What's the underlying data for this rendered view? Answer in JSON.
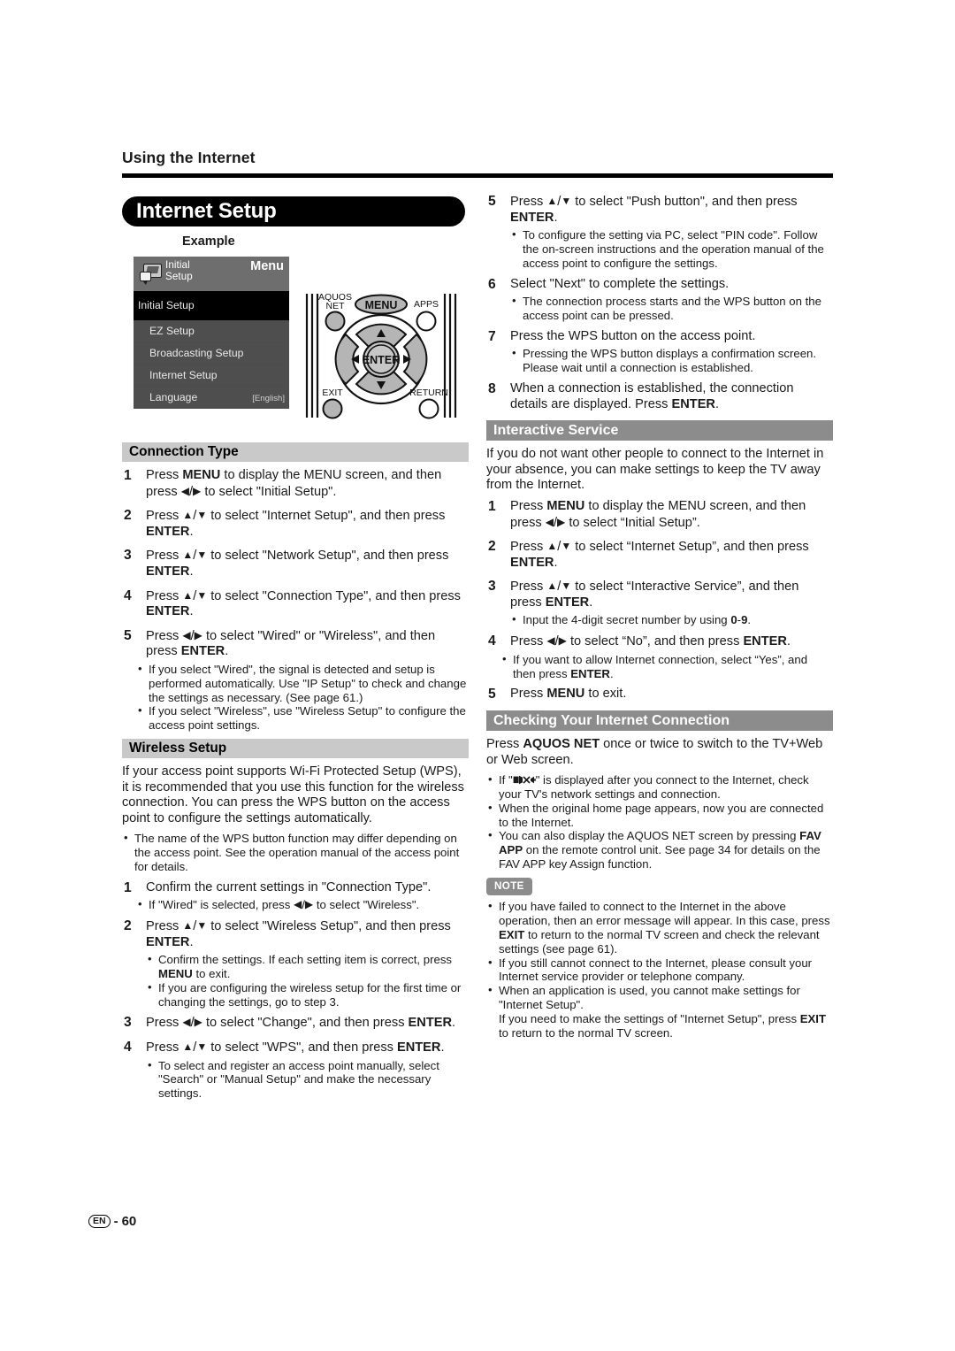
{
  "running_head": "Using the Internet",
  "page_title": "Internet Setup",
  "footer": {
    "lang_code": "EN",
    "separator": "-",
    "page_number": "60"
  },
  "example": {
    "label": "Example",
    "menu": {
      "header_icon": "initial-setup-icon",
      "header_title_line1": "Initial",
      "header_title_line2": "Setup",
      "header_right": "Menu",
      "rows": [
        {
          "label": "Initial Setup",
          "selected": true,
          "value": ""
        },
        {
          "label": "EZ Setup",
          "selected": false,
          "value": ""
        },
        {
          "label": "Broadcasting Setup",
          "selected": false,
          "value": ""
        },
        {
          "label": "Internet Setup",
          "selected": false,
          "value": ""
        },
        {
          "label": "Language",
          "selected": false,
          "value": "[English]"
        }
      ]
    },
    "remote": {
      "aquos_net": "AQUOS\nNET",
      "aquos_net_line1": "AQUOS",
      "aquos_net_line2": "NET",
      "menu": "MENU",
      "apps": "APPS",
      "enter": "ENTER",
      "exit": "EXIT",
      "return": "RETURN"
    }
  },
  "left_column": {
    "connection_type": {
      "heading": "Connection Type",
      "steps": [
        {
          "num": "1",
          "html": "Press <b>MENU</b> to display the MENU screen, and then press <span class=\"ar\">◀</span>/<span class=\"ar\">▶</span> to select \"Initial Setup\"."
        },
        {
          "num": "2",
          "html": "Press <span class=\"ar\">▲</span>/<span class=\"ar\">▼</span> to select \"Internet Setup\", and then press <b>ENTER</b>."
        },
        {
          "num": "3",
          "html": "Press <span class=\"ar\">▲</span>/<span class=\"ar\">▼</span> to select \"Network Setup\", and then press <b>ENTER</b>."
        },
        {
          "num": "4",
          "html": "Press <span class=\"ar\">▲</span>/<span class=\"ar\">▼</span> to select \"Connection Type\", and then press <b>ENTER</b>."
        },
        {
          "num": "5",
          "html": "Press <span class=\"ar\">◀</span>/<span class=\"ar\">▶</span> to select \"Wired\" or \"Wireless\", and then press <b>ENTER</b>."
        }
      ],
      "step5_bullets": [
        "If you select \"Wired\", the signal is detected and setup is performed automatically. Use \"IP Setup\" to check and change the settings as necessary. (See page 61.)",
        "If you select \"Wireless\", use \"Wireless Setup\" to configure the access point settings."
      ]
    },
    "wireless_setup": {
      "heading": "Wireless Setup",
      "intro": "If your access point supports Wi-Fi Protected Setup (WPS), it is recommended that you use this function for the wireless connection. You can press the WPS button on the access point to configure the settings automatically.",
      "intro_bullets": [
        "The name of the WPS button function may differ depending on the access point. See the operation manual of the access point for details."
      ],
      "steps": [
        {
          "num": "1",
          "html": "Confirm the current settings in \"Connection Type\"."
        },
        {
          "num": "2",
          "html": "Press <span class=\"ar\">▲</span>/<span class=\"ar\">▼</span> to select \"Wireless Setup\", and then press <b>ENTER</b>."
        },
        {
          "num": "3",
          "html": "Press <span class=\"ar\">◀</span>/<span class=\"ar\">▶</span> to select \"Change\", and then press <b>ENTER</b>."
        },
        {
          "num": "4",
          "html": "Press <span class=\"ar\">▲</span>/<span class=\"ar\">▼</span> to select \"WPS\", and then press <b>ENTER</b>."
        }
      ],
      "step1_bullets": [
        "If \"Wired\" is selected, press <span class=\"ar\">◀</span>/<span class=\"ar\">▶</span> to select \"Wireless\"."
      ],
      "step2_bullets": [
        "Confirm the settings. If each setting item is correct, press <b>MENU</b> to exit.",
        "If you are configuring the wireless setup for the first time or changing the settings, go to step 3."
      ],
      "step4_bullets": [
        "To select and register an access point manually, select \"Search\" or \"Manual Setup\" and make the necessary settings."
      ]
    }
  },
  "right_column": {
    "wireless_steps_continued": [
      {
        "num": "5",
        "html": "Press <span class=\"ar\">▲</span>/<span class=\"ar\">▼</span> to select \"Push button\", and then press <b>ENTER</b>."
      },
      {
        "num": "6",
        "html": "Select \"Next\" to complete the settings."
      },
      {
        "num": "7",
        "html": "Press the WPS button on the access point."
      },
      {
        "num": "8",
        "html": "When a connection is established, the connection details are displayed. Press <b>ENTER</b>."
      }
    ],
    "step5_bullets": [
      "To configure the setting via PC, select \"PIN code\". Follow the on-screen instructions and the operation manual of the access point to configure the settings."
    ],
    "step6_bullets": [
      "The connection process starts and the WPS button on the access point can be pressed."
    ],
    "step7_bullets": [
      "Pressing the WPS button displays a confirmation screen. Please wait until a connection is established."
    ],
    "interactive_service": {
      "heading": "Interactive Service",
      "intro": "If you do not want other people to connect to the Internet in your absence, you can make settings to keep the TV away from the Internet.",
      "steps": [
        {
          "num": "1",
          "html": "Press <b>MENU</b> to display the MENU screen, and then press <span class=\"ar\">◀</span>/<span class=\"ar\">▶</span> to select “Initial Setup”."
        },
        {
          "num": "2",
          "html": "Press <span class=\"ar\">▲</span>/<span class=\"ar\">▼</span> to select “Internet Setup”, and then press <b>ENTER</b>."
        },
        {
          "num": "3",
          "html": "Press <span class=\"ar\">▲</span>/<span class=\"ar\">▼</span> to select “Interactive Service”, and then press <b>ENTER</b>."
        },
        {
          "num": "4",
          "html": "Press <span class=\"ar\">◀</span>/<span class=\"ar\">▶</span> to select “No”, and then press <b>ENTER</b>."
        },
        {
          "num": "5",
          "html": "Press <b>MENU</b> to exit."
        }
      ],
      "step3_bullets": [
        "Input the 4-digit secret number by using <b>0</b>-<b>9</b>."
      ],
      "step4_bullets": [
        "If you want to allow Internet connection, select “Yes”, and then press <b>ENTER</b>."
      ]
    },
    "checking_connection": {
      "heading": "Checking Your Internet Connection",
      "intro": "Press <b>AQUOS NET</b> once or twice to switch to the TV+Web or Web screen.",
      "bullets": [
        "If \"<span class=\"nosig\" data-name=\"no-signal-icon\"></span>\" is displayed after you connect to the Internet, check your TV's network settings and connection.",
        "When the original home page appears, now you are connected to the Internet.",
        "You can also display the AQUOS NET screen by pressing <b>FAV APP</b> on the remote control unit. See page 34 for details on the FAV APP key Assign function."
      ]
    },
    "note": {
      "badge": "NOTE",
      "bullets": [
        "If you have failed to connect to the Internet in the above operation, then an error message will appear. In this case, press <b>EXIT</b> to return to the normal TV screen and check the relevant settings (see page 61).",
        "If you still cannot connect to the Internet, please consult your Internet service provider or telephone company.",
        "When an application is used, you cannot make settings for \"Internet Setup\".<span class=\"sub\">If you need to make the settings of \"Internet Setup\", press <b>EXIT</b> to return to the normal TV screen.</span>"
      ]
    }
  },
  "colors": {
    "section_bar_light": "#c9c9c9",
    "section_bar_dark": "#8c8c8c",
    "title_pill": "#000000",
    "menu_header": "#6e6e6e",
    "menu_row": "#4e4e4e",
    "menu_row_selected": "#000000"
  }
}
